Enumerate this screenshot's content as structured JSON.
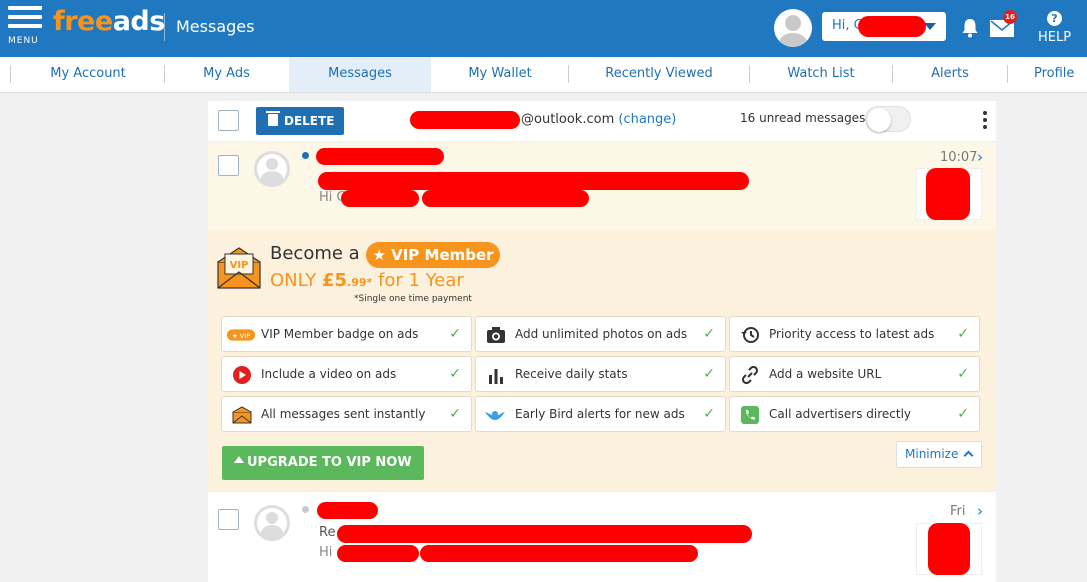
{
  "header": {
    "menu_label": "MENU",
    "logo_part1": "free",
    "logo_part2": "ads",
    "title": "Messages",
    "user_greeting": "Hi, C",
    "notification_count": "16",
    "help_label": "HELP",
    "help_icon": "?"
  },
  "nav": {
    "items": [
      {
        "label": "My Account"
      },
      {
        "label": "My Ads"
      },
      {
        "label": "Messages"
      },
      {
        "label": "My Wallet"
      },
      {
        "label": "Recently Viewed"
      },
      {
        "label": "Watch List"
      },
      {
        "label": "Alerts"
      },
      {
        "label": "Profile"
      }
    ],
    "active": "Messages"
  },
  "toolbar": {
    "delete_label": "DELETE",
    "email_prefix": "",
    "email_suffix": "@outlook.com",
    "change_label": "(change)",
    "unread_label": "16 unread messages",
    "toggle_on": false
  },
  "messages": [
    {
      "time": "10:07",
      "unread": true,
      "snippet_prefix": "Hi C"
    },
    {
      "time": "Fri",
      "unread": false,
      "snippet_prefix": "Hi",
      "subject_prefix": "Re"
    }
  ],
  "vip": {
    "title_prefix": "Become a",
    "pill": "★ VIP Member",
    "price_prefix": "ONLY ",
    "price_main": "£5",
    "price_small": ".99*",
    "price_suffix": " for 1 Year",
    "note": "*Single one time payment",
    "features": [
      {
        "label": "VIP Member badge on ads",
        "icon": "vip-badge-icon"
      },
      {
        "label": "Add unlimited photos on ads",
        "icon": "camera-icon"
      },
      {
        "label": "Priority access to latest ads",
        "icon": "history-icon"
      },
      {
        "label": "Include a video on ads",
        "icon": "play-icon"
      },
      {
        "label": "Receive daily stats",
        "icon": "bar-chart-icon"
      },
      {
        "label": "Add a website URL",
        "icon": "link-icon"
      },
      {
        "label": "All messages sent instantly",
        "icon": "envelope-icon"
      },
      {
        "label": "Early Bird alerts for new ads",
        "icon": "bird-icon"
      },
      {
        "label": "Call advertisers directly",
        "icon": "phone-icon"
      }
    ],
    "check_symbol": "✓",
    "upgrade_label": "UPGRADE TO VIP NOW >>",
    "minimize_label": "Minimize"
  },
  "colors": {
    "brand_blue": "#1f78c0",
    "brand_orange": "#f7941d",
    "success_green": "#5cb85c",
    "redaction": "#ff0000"
  }
}
